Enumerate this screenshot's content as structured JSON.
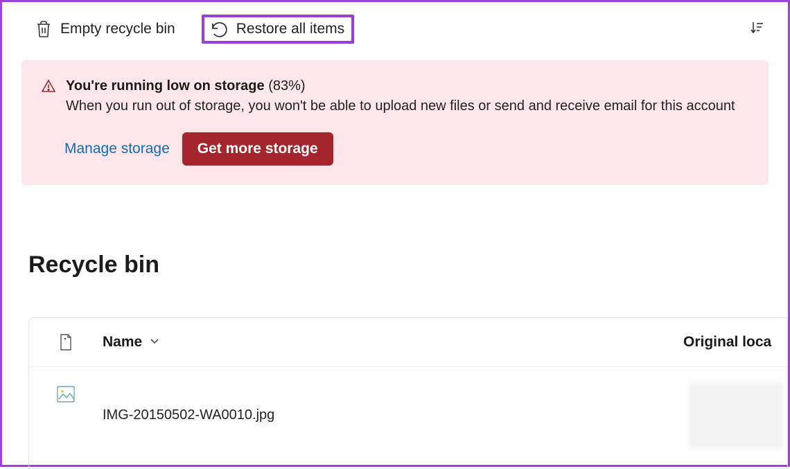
{
  "toolbar": {
    "empty_label": "Empty recycle bin",
    "restore_label": "Restore all items"
  },
  "banner": {
    "title_bold": "You're running low on storage",
    "title_pct": "(83%)",
    "desc": "When you run out of storage, you won't be able to upload new files or send and receive email for this account",
    "manage_label": "Manage storage",
    "getmore_label": "Get more storage"
  },
  "page": {
    "title": "Recycle bin"
  },
  "table": {
    "name_header": "Name",
    "loc_header": "Original loca",
    "rows": [
      {
        "name": "IMG-20150502-WA0010.jpg"
      }
    ]
  }
}
